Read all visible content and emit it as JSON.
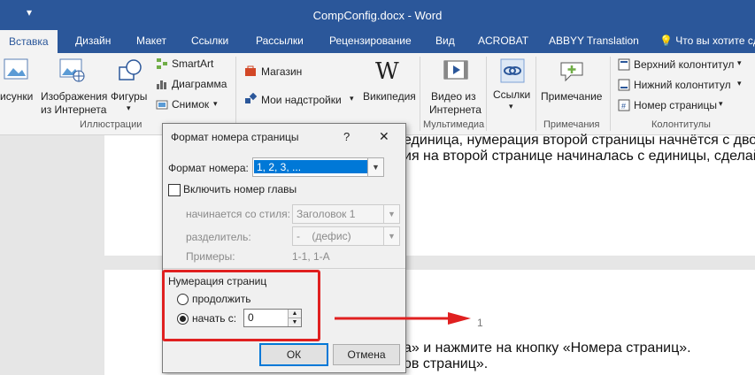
{
  "window": {
    "title": "CompConfig.docx - Word",
    "qat_icon": "customize-quick-access-icon"
  },
  "tabs": [
    {
      "label": "Вставка",
      "active": true
    },
    {
      "label": "Дизайн"
    },
    {
      "label": "Макет"
    },
    {
      "label": "Ссылки"
    },
    {
      "label": "Рассылки"
    },
    {
      "label": "Рецензирование"
    },
    {
      "label": "Вид"
    },
    {
      "label": "ACROBAT"
    },
    {
      "label": "ABBYY Translation"
    }
  ],
  "tell_me": "Что вы хотите сд",
  "ribbon": {
    "illustrations": {
      "pictures": "исунки",
      "online_pictures_1": "Изображения",
      "online_pictures_2": "из Интернета",
      "shapes": "Фигуры",
      "smartart": "SmartArt",
      "chart": "Диаграмма",
      "screenshot": "Снимок",
      "group": "Иллюстрации"
    },
    "addins": {
      "store": "Магазин",
      "my_addins": "Мои надстройки",
      "wikipedia": "Википедия"
    },
    "media": {
      "video_1": "Видео из",
      "video_2": "Интернета",
      "group": "Мультимедиа"
    },
    "links": {
      "label": "Ссылки"
    },
    "comments": {
      "label": "Примечание",
      "group": "Примечания"
    },
    "header_footer": {
      "header": "Верхний колонтитул",
      "footer": "Нижний колонтитул",
      "page_number": "Номер страницы",
      "group": "Колонтитулы"
    }
  },
  "document": {
    "line1": "единица, нумерация второй страницы начнётся с двойки.",
    "line2": "ия на второй странице начиналась с единицы, сделайте",
    "line3": "а» и нажмите на кнопку «Номера страниц».",
    "line4": "ов страниц».",
    "page_number": "1"
  },
  "dialog": {
    "title": "Формат номера страницы",
    "help": "?",
    "close": "✕",
    "number_format_label": "Формат номера:",
    "number_format_value": "1, 2, 3, ...",
    "include_chapter": "Включить номер главы",
    "starts_with_style_label": "начинается со стиля:",
    "starts_with_style_value": "Заголовок 1",
    "separator_label": "разделитель:",
    "separator_value": "-    (дефис)",
    "examples_label": "Примеры:",
    "examples_value": "1-1, 1-А",
    "numbering_section": "Нумерация страниц",
    "continue_label": "продолжить",
    "start_at_label": "начать с:",
    "start_at_value": "0",
    "ok": "ОК",
    "cancel": "Отмена"
  },
  "annotation": {
    "color": "#e02020"
  }
}
